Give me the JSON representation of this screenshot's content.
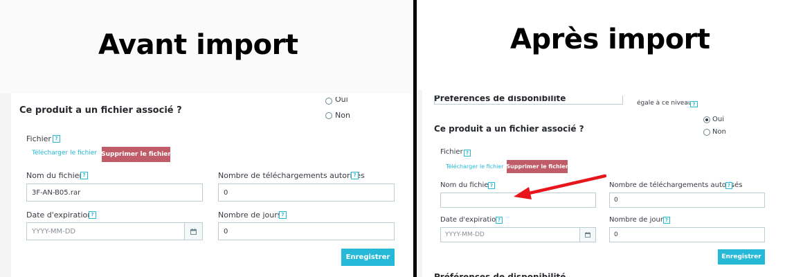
{
  "left": {
    "heading": "Avant import",
    "radio_top_label": "Oui",
    "radio_non_label": "Non",
    "section_title": "Ce produit a un fichier associé ?",
    "fichier_label": "Fichier",
    "download_link": "Télécharger le fichier",
    "delete_button": "Supprimer le fichier",
    "filename_label": "Nom du fichier",
    "filename_value": "3F-AN-B05.rar",
    "downloads_label": "Nombre de téléchargements autorisés",
    "downloads_value": "0",
    "expiration_label": "Date d'expiration",
    "expiration_placeholder": "YYYY-MM-DD",
    "days_label": "Nombre de jours",
    "days_value": "0",
    "save_button": "Enregistrer"
  },
  "right": {
    "heading": "Après import",
    "top_cut_text": "Préférences de disponibilité",
    "top_right_text": "égale à ce niveau",
    "radio_oui_label": "Oui",
    "radio_non_label": "Non",
    "section_title": "Ce produit a un fichier associé ?",
    "fichier_label": "Fichier",
    "download_link": "Télécharger le fichier",
    "delete_button": "Supprimer le fichier",
    "filename_label": "Nom du fichier",
    "filename_value": "",
    "downloads_label": "Nombre de téléchargements autorisés",
    "downloads_value": "0",
    "expiration_label": "Date d'expiration",
    "expiration_placeholder": "YYYY-MM-DD",
    "days_label": "Nombre de jours",
    "days_value": "0",
    "save_button": "Enregistrer",
    "bottom_cut_text": "Préférences de disponibilité"
  },
  "help_glyph": "?",
  "icons": {
    "calendar": "calendar-icon",
    "arrow": "red-arrow-icon"
  },
  "colors": {
    "accent": "#25b9d7",
    "danger": "#c05c67",
    "arrow": "#e8161b",
    "divider": "#000000"
  }
}
